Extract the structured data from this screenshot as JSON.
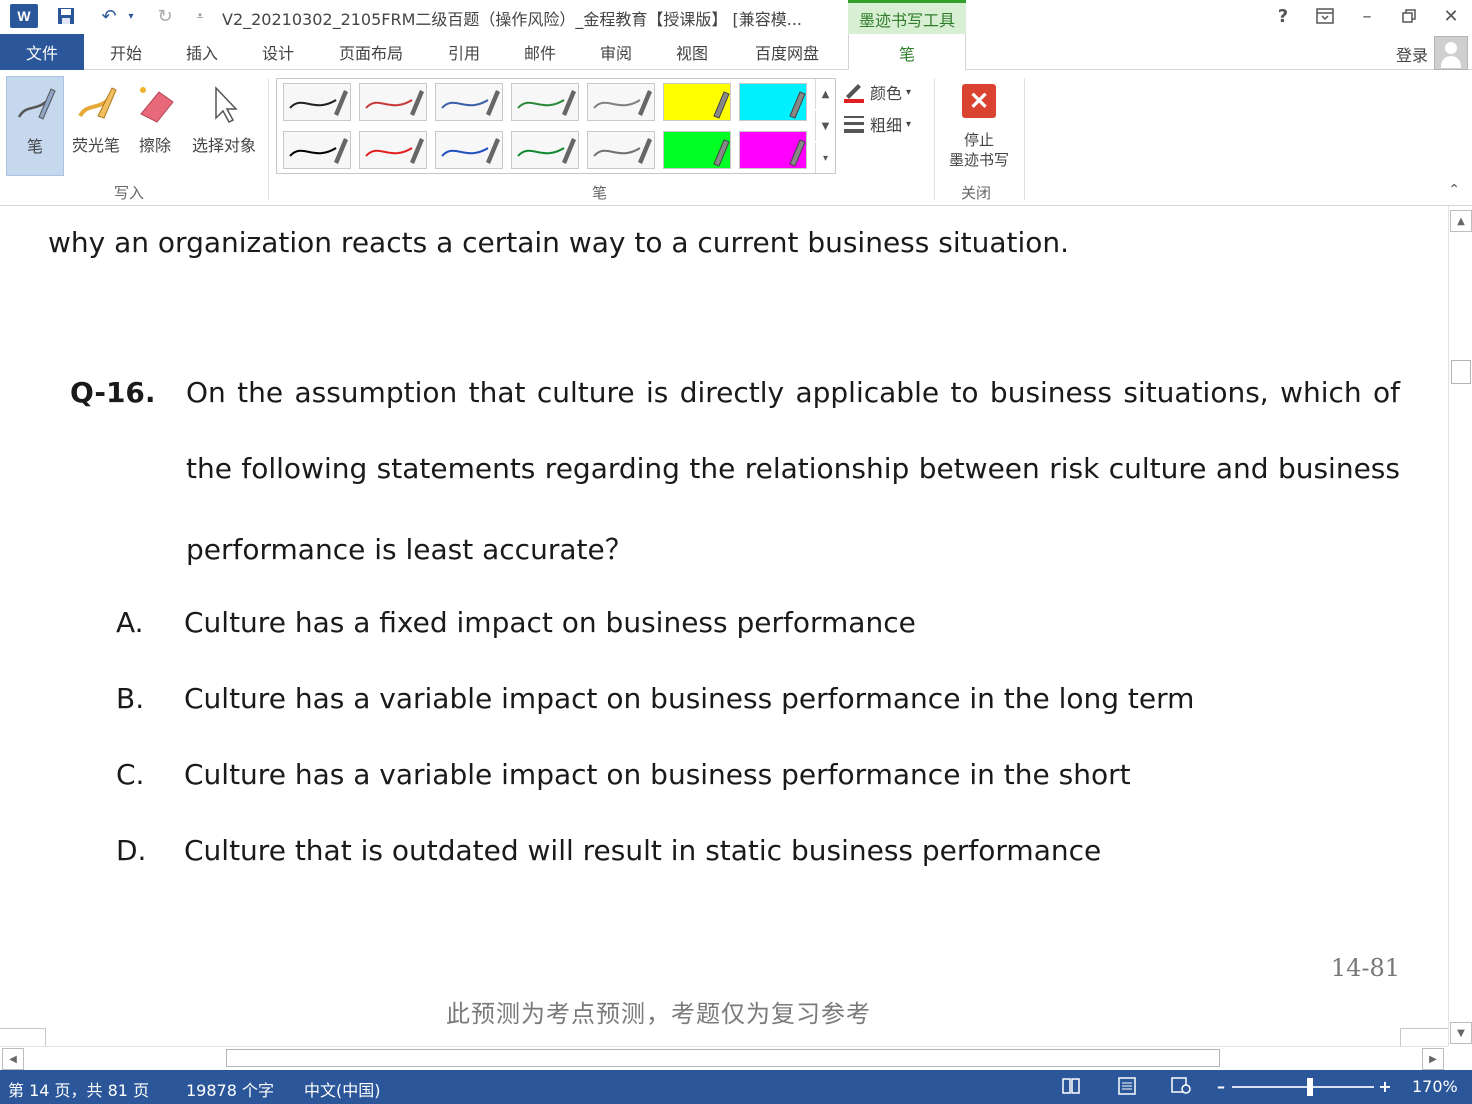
{
  "app": {
    "logo": "W",
    "doc_title": "V2_20210302_2105FRM二级百题（操作风险）_金程教育【授课版】 [兼容模...",
    "context_tab_title": "墨迹书写工具",
    "help": "?",
    "login": "登录"
  },
  "quick_access": {
    "save_icon": "save-icon",
    "undo_icon": "undo-icon",
    "redo_icon": "redo-icon"
  },
  "tabs": [
    {
      "label": "文件"
    },
    {
      "label": "开始"
    },
    {
      "label": "插入"
    },
    {
      "label": "设计"
    },
    {
      "label": "页面布局"
    },
    {
      "label": "引用"
    },
    {
      "label": "邮件"
    },
    {
      "label": "审阅"
    },
    {
      "label": "视图"
    },
    {
      "label": "百度网盘"
    },
    {
      "label": "笔"
    }
  ],
  "ribbon": {
    "write_group": {
      "label": "写入",
      "buttons": [
        {
          "label": "笔"
        },
        {
          "label": "荧光笔"
        },
        {
          "label": "擦除"
        },
        {
          "label": "选择对象"
        }
      ]
    },
    "pens_group": {
      "label": "笔",
      "swatches_top": [
        "#202020",
        "#c83a3a",
        "#3a5fa8",
        "#2a8a3a",
        "#808080",
        "#ffff00",
        "#00f0ff"
      ],
      "swatches_bottom": [
        "#000000",
        "#e02020",
        "#1f4fbf",
        "#108a30",
        "#707070",
        "#00ff22",
        "#ff00ff"
      ],
      "color_label": "颜色",
      "thickness_label": "粗细"
    },
    "close_group": {
      "label": "关闭",
      "stop_line1": "停止",
      "stop_line2": "墨迹书写"
    }
  },
  "document": {
    "prev_line": "why an organization reacts a certain way to a current business situation.",
    "question": {
      "number": "Q-16.",
      "line1": "On the assumption that culture is directly applicable to business situations, which of",
      "line2": "the following statements regarding the relationship between risk culture and business",
      "line3": "performance is least accurate？"
    },
    "options": [
      {
        "letter": "A.",
        "text": "Culture has a fixed impact on business performance"
      },
      {
        "letter": "B.",
        "text": "Culture has a variable impact on business performance in the long term"
      },
      {
        "letter": "C.",
        "text": "Culture has a variable impact on business performance in the short"
      },
      {
        "letter": "D.",
        "text": "Culture that is outdated will result in static business performance"
      }
    ],
    "page_number": "14-81",
    "footer_note": "此预测为考点预测，考题仅为复习参考"
  },
  "status": {
    "page": "第 14 页，共 81 页",
    "words": "19878 个字",
    "language": "中文(中国)",
    "zoom": "170%",
    "zoom_fraction": 0.55
  }
}
